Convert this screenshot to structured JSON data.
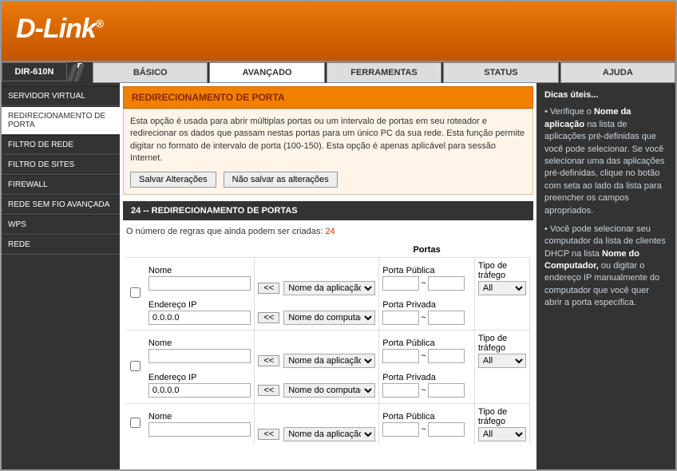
{
  "logo": "D-Link",
  "model": "DIR-610N",
  "nav": {
    "tabs": [
      "BÁSICO",
      "AVANÇADO",
      "FERRAMENTAS",
      "STATUS",
      "AJUDA"
    ],
    "active": 1
  },
  "sidebar": {
    "items": [
      "SERVIDOR VIRTUAL",
      "REDIRECIONAMENTO DE PORTA",
      "FILTRO DE REDE",
      "FILTRO DE SITES",
      "FIREWALL",
      "REDE SEM FIO AVANÇADA",
      "WPS",
      "REDE"
    ],
    "active": 1
  },
  "main": {
    "section_title": "REDIRECIONAMENTO DE PORTA",
    "intro": "Esta opção é usada para abrir múltiplas portas ou um intervalo de portas em seu roteador e redirecionar os dados que passam nestas portas para um único PC da sua rede. Esta função permite digitar no formato de intervalo de porta (100-150). Esta opção é apenas aplicável para sessão Internet.",
    "save_btn": "Salvar Alterações",
    "cancel_btn": "Não salvar as alterações",
    "sub_title": "24 -- REDIRECIONAMENTO DE PORTAS",
    "rules_remaining_label": "O número de regras que ainda podem ser criadas: ",
    "rules_remaining_count": "24",
    "ports_header": "Portas",
    "labels": {
      "name": "Nome",
      "ip": "Endereço IP",
      "public_port": "Porta Pública",
      "private_port": "Porta Privada",
      "traffic_type": "Tipo de tráfego",
      "app_select": "Nome da aplicação",
      "computer_select": "Nome do computado",
      "arrow": "<<",
      "tilde": "~",
      "traffic_all": "All"
    },
    "rows": [
      {
        "name": "",
        "ip": "0.0.0.0"
      },
      {
        "name": "",
        "ip": "0.0.0.0"
      },
      {
        "name": "",
        "ip": ""
      }
    ]
  },
  "tips": {
    "title": "Dicas úteis...",
    "p1a": "Verifique o ",
    "p1b": "Nome da aplicação",
    "p1c": " na lista de aplicações pré-definidas que você pode selecionar. Se você selecionar uma das aplicações pré-definidas, clique no botão com seta ao lado da lista para preencher os campos apropriados.",
    "p2a": "Você pode selecionar seu computador da lista de clientes DHCP na lista ",
    "p2b": "Nome do Computador,",
    "p2c": " ou digitar o endereço IP manualmente do computador que você quer abrir a porta específica."
  }
}
